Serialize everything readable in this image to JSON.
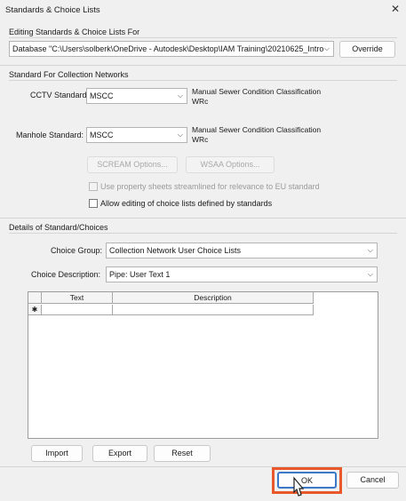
{
  "dialog": {
    "title": "Standards & Choice Lists",
    "close_glyph": "✕"
  },
  "editing": {
    "group_label": "Editing Standards & Choice Lists For",
    "database_value": "Database \"C:\\Users\\solberk\\OneDrive - Autodesk\\Desktop\\IAM Training\\20210625_Intro",
    "override_label": "Override"
  },
  "collection": {
    "group_label": "Standard For Collection Networks",
    "cctv_label": "CCTV Standard:",
    "cctv_value": "MSCC",
    "cctv_desc_line1": "Manual Sewer Condition Classification",
    "cctv_desc_line2": "WRc",
    "manhole_label": "Manhole Standard:",
    "manhole_value": "MSCC",
    "manhole_desc_line1": "Manual Sewer Condition Classification",
    "manhole_desc_line2": "WRc",
    "scream_label": "SCREAM Options...",
    "wsaa_label": "WSAA Options...",
    "property_sheets_label": "Use property sheets streamlined for relevance to EU standard",
    "allow_editing_label": "Allow editing of choice lists defined by standards"
  },
  "details": {
    "group_label": "Details of Standard/Choices",
    "choice_group_label": "Choice Group:",
    "choice_group_value": "Collection Network User Choice Lists",
    "choice_desc_label": "Choice Description:",
    "choice_desc_value": "Pipe: User Text 1",
    "grid": {
      "col_text": "Text",
      "col_description": "Description",
      "new_row_marker": "✱"
    },
    "import_label": "Import",
    "export_label": "Export",
    "reset_label": "Reset"
  },
  "footer": {
    "ok_label": "OK",
    "cancel_label": "Cancel"
  },
  "icons": {
    "dropdown": "chevron-down-icon",
    "close": "close-icon",
    "cursor": "mouse-pointer-icon"
  },
  "colors": {
    "highlight": "#e8582a",
    "ok_border": "#3c78c8"
  }
}
